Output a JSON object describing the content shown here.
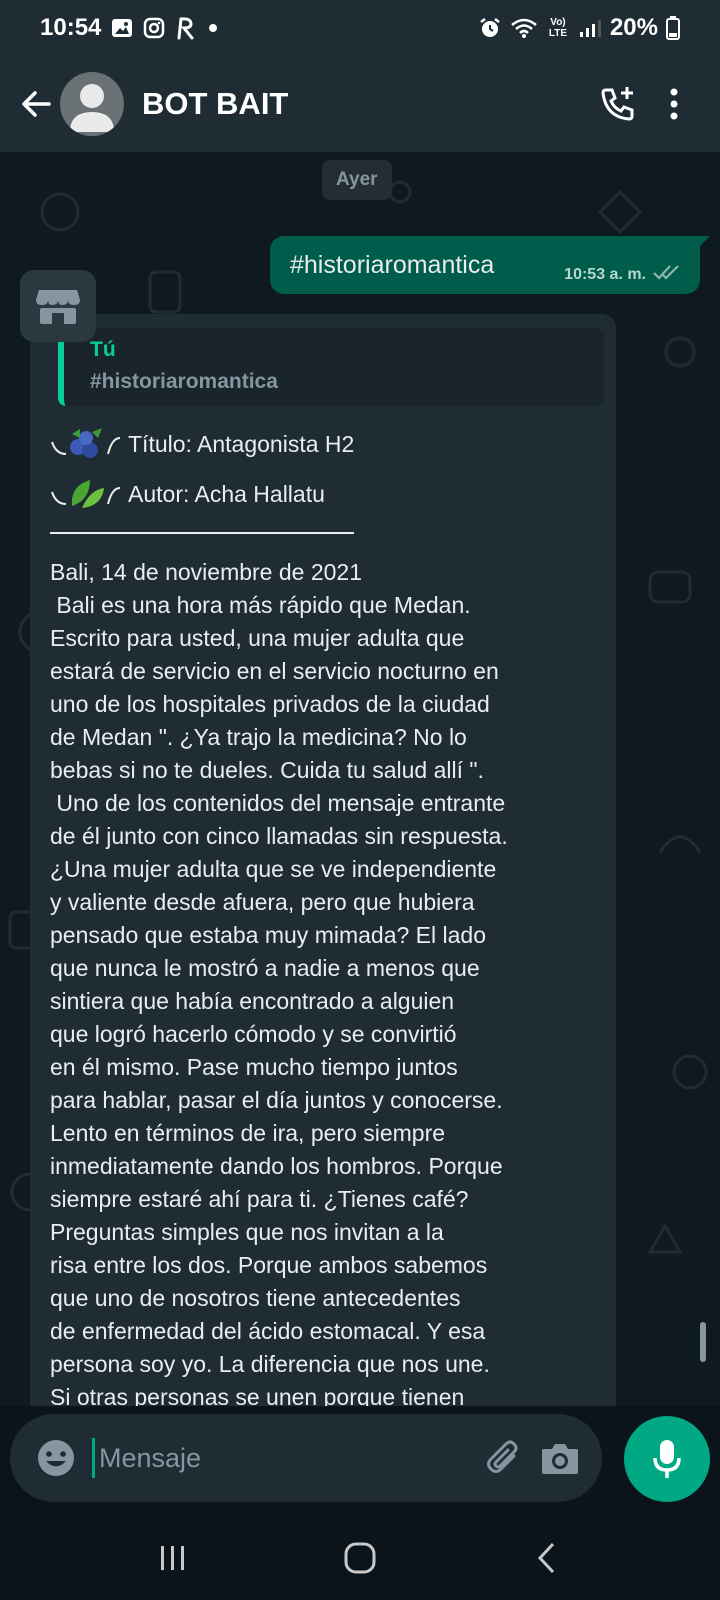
{
  "status_bar": {
    "time": "10:54",
    "battery": "20%",
    "network": "Vo) LTE",
    "icons": [
      "gallery-icon",
      "instagram-icon",
      "r-app-icon",
      "dot-icon",
      "alarm-icon",
      "wifi-icon",
      "signal-icon",
      "battery-icon"
    ]
  },
  "header": {
    "title": "BOT BAIT",
    "icons": [
      "back-arrow-icon",
      "avatar-placeholder-icon",
      "add-call-icon",
      "more-vert-icon"
    ]
  },
  "chat": {
    "date_chip": "Ayer",
    "outgoing": {
      "text": "#historiaromantica",
      "time": "10:53 a. m.",
      "status_icon": "double-check-icon"
    },
    "incoming": {
      "avatar_icon": "store-icon",
      "quote_author": "Tú",
      "quote_text": "#historiaromantica",
      "title_line": "Título: Antagonista H2",
      "author_line": "Autor: Acha Hallatu",
      "emojis": [
        "blueberries-emoji",
        "leaf-emoji"
      ],
      "body": "Bali, 14 de noviembre de 2021\n Bali es una hora más rápido que Medan.\nEscrito para usted, una mujer adulta que\nestará de servicio en el servicio nocturno en\nuno de los hospitales privados de la ciudad\nde Medan \". ¿Ya trajo la medicina? No lo\nbebas si no te dueles. Cuida tu salud allí \".\n Uno de los contenidos del mensaje entrante\nde él junto con cinco llamadas sin respuesta.\n¿Una mujer adulta que se ve independiente\ny valiente desde afuera, pero que hubiera\npensado que estaba muy mimada? El lado\nque nunca le mostró a nadie a menos que\nsintiera que había encontrado a alguien\nque logró hacerlo cómodo y se convirtió\nen él mismo. Pase mucho tiempo juntos\npara hablar, pasar el día juntos y conocerse.\nLento en términos de ira, pero siempre\ninmediatamente dando los hombros. Porque\nsiempre estaré ahí para ti. ¿Tienes café?\nPreguntas simples que nos invitan a la\nrisa entre los dos. Porque ambos sabemos\nque uno de nosotros tiene antecedentes\nde enfermedad del ácido estomacal. Y esa\npersona soy yo. La diferencia que nos une.\nSi otras personas se unen porque tienen\nalgo en común, inversamente proporcional"
    }
  },
  "input": {
    "placeholder": "Mensaje",
    "icons": [
      "emoji-icon",
      "attach-icon",
      "camera-icon",
      "mic-icon"
    ]
  },
  "nav": {
    "icons": [
      "recent-apps-icon",
      "home-icon",
      "back-icon"
    ]
  },
  "colors": {
    "header_bg": "#1f2c34",
    "chat_bg": "#0e1a20",
    "outgoing_bubble": "#005c4b",
    "incoming_bubble": "#1f2c34",
    "accent": "#00a884",
    "quote_accent": "#06cf9c"
  }
}
